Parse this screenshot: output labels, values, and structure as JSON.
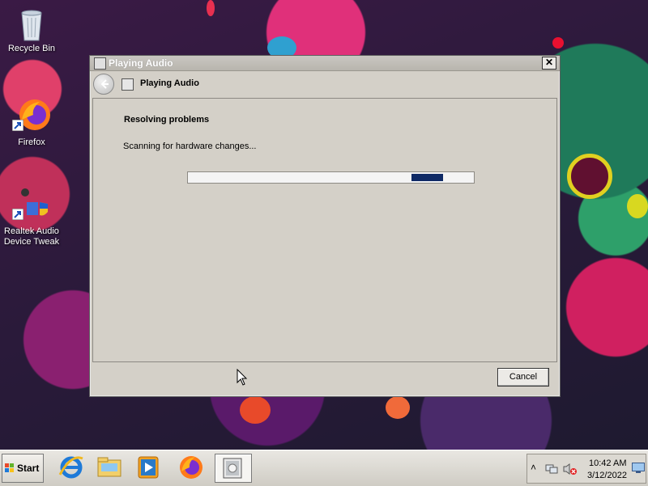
{
  "desktop": {
    "icons": [
      {
        "label": "Recycle Bin"
      },
      {
        "label": "Firefox"
      },
      {
        "label": "Realtek Audio\nDevice Tweak"
      }
    ]
  },
  "dialog": {
    "window_title": "Playing Audio",
    "nav_title": "Playing Audio",
    "heading": "Resolving problems",
    "status_text": "Scanning for hardware changes...",
    "progress_mode": "marquee",
    "cancel_label": "Cancel",
    "close_glyph": "✕"
  },
  "taskbar": {
    "start_label": "Start",
    "pinned": [
      {
        "icon": "internet-explorer-icon"
      },
      {
        "icon": "file-explorer-icon"
      },
      {
        "icon": "media-player-icon"
      },
      {
        "icon": "firefox-icon"
      },
      {
        "icon": "troubleshooter-window-icon",
        "active": true
      }
    ],
    "tray": {
      "overflow_glyph": "˄",
      "time": "10:42 AM",
      "date": "3/12/2022"
    }
  },
  "colors": {
    "dialog_bg": "#d4d0c8",
    "progress_chunk": "#0f2a66",
    "title_text": "#ffffff"
  }
}
